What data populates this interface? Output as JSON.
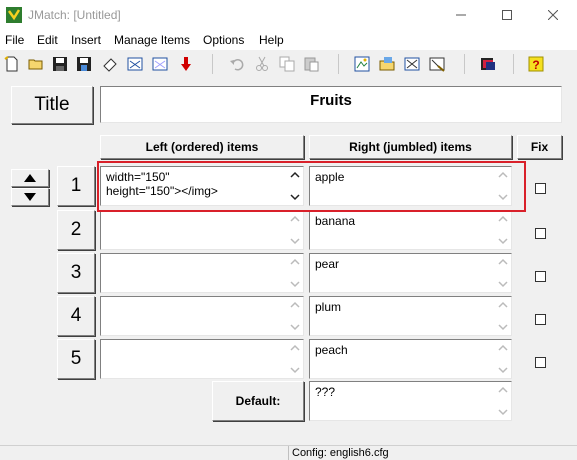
{
  "window": {
    "title": "JMatch: [Untitled]"
  },
  "menu": [
    "File",
    "Edit",
    "Insert",
    "Manage Items",
    "Options",
    "Help"
  ],
  "toolbar": {
    "icons": [
      "new-file-icon",
      "open-folder-icon",
      "save-icon",
      "save-as-icon",
      "eraser-icon",
      "web-page-icon",
      "export-icon",
      "arrow-down-icon",
      "undo-icon",
      "cut-icon",
      "copy-icon",
      "paste-icon",
      "image-icon",
      "folder-image-icon",
      "configure-icon",
      "config-edit-icon",
      "dictionary-icon",
      "help-icon"
    ]
  },
  "title_button": "Title",
  "title_value": "Fruits",
  "headers": {
    "left": "Left (ordered) items",
    "right": "Right (jumbled) items",
    "fix": "Fix"
  },
  "rows": [
    {
      "number": "1",
      "left": "width=\"150\"\nheight=\"150\"></img>",
      "right": "apple"
    },
    {
      "number": "2",
      "left": "",
      "right": "banana"
    },
    {
      "number": "3",
      "left": "",
      "right": "pear"
    },
    {
      "number": "4",
      "left": "",
      "right": "plum"
    },
    {
      "number": "5",
      "left": "",
      "right": "peach"
    }
  ],
  "default": {
    "label": "Default:",
    "value": "???"
  },
  "status": {
    "config": "Config: english6.cfg"
  },
  "colors": {
    "highlight": "#d9202a"
  }
}
